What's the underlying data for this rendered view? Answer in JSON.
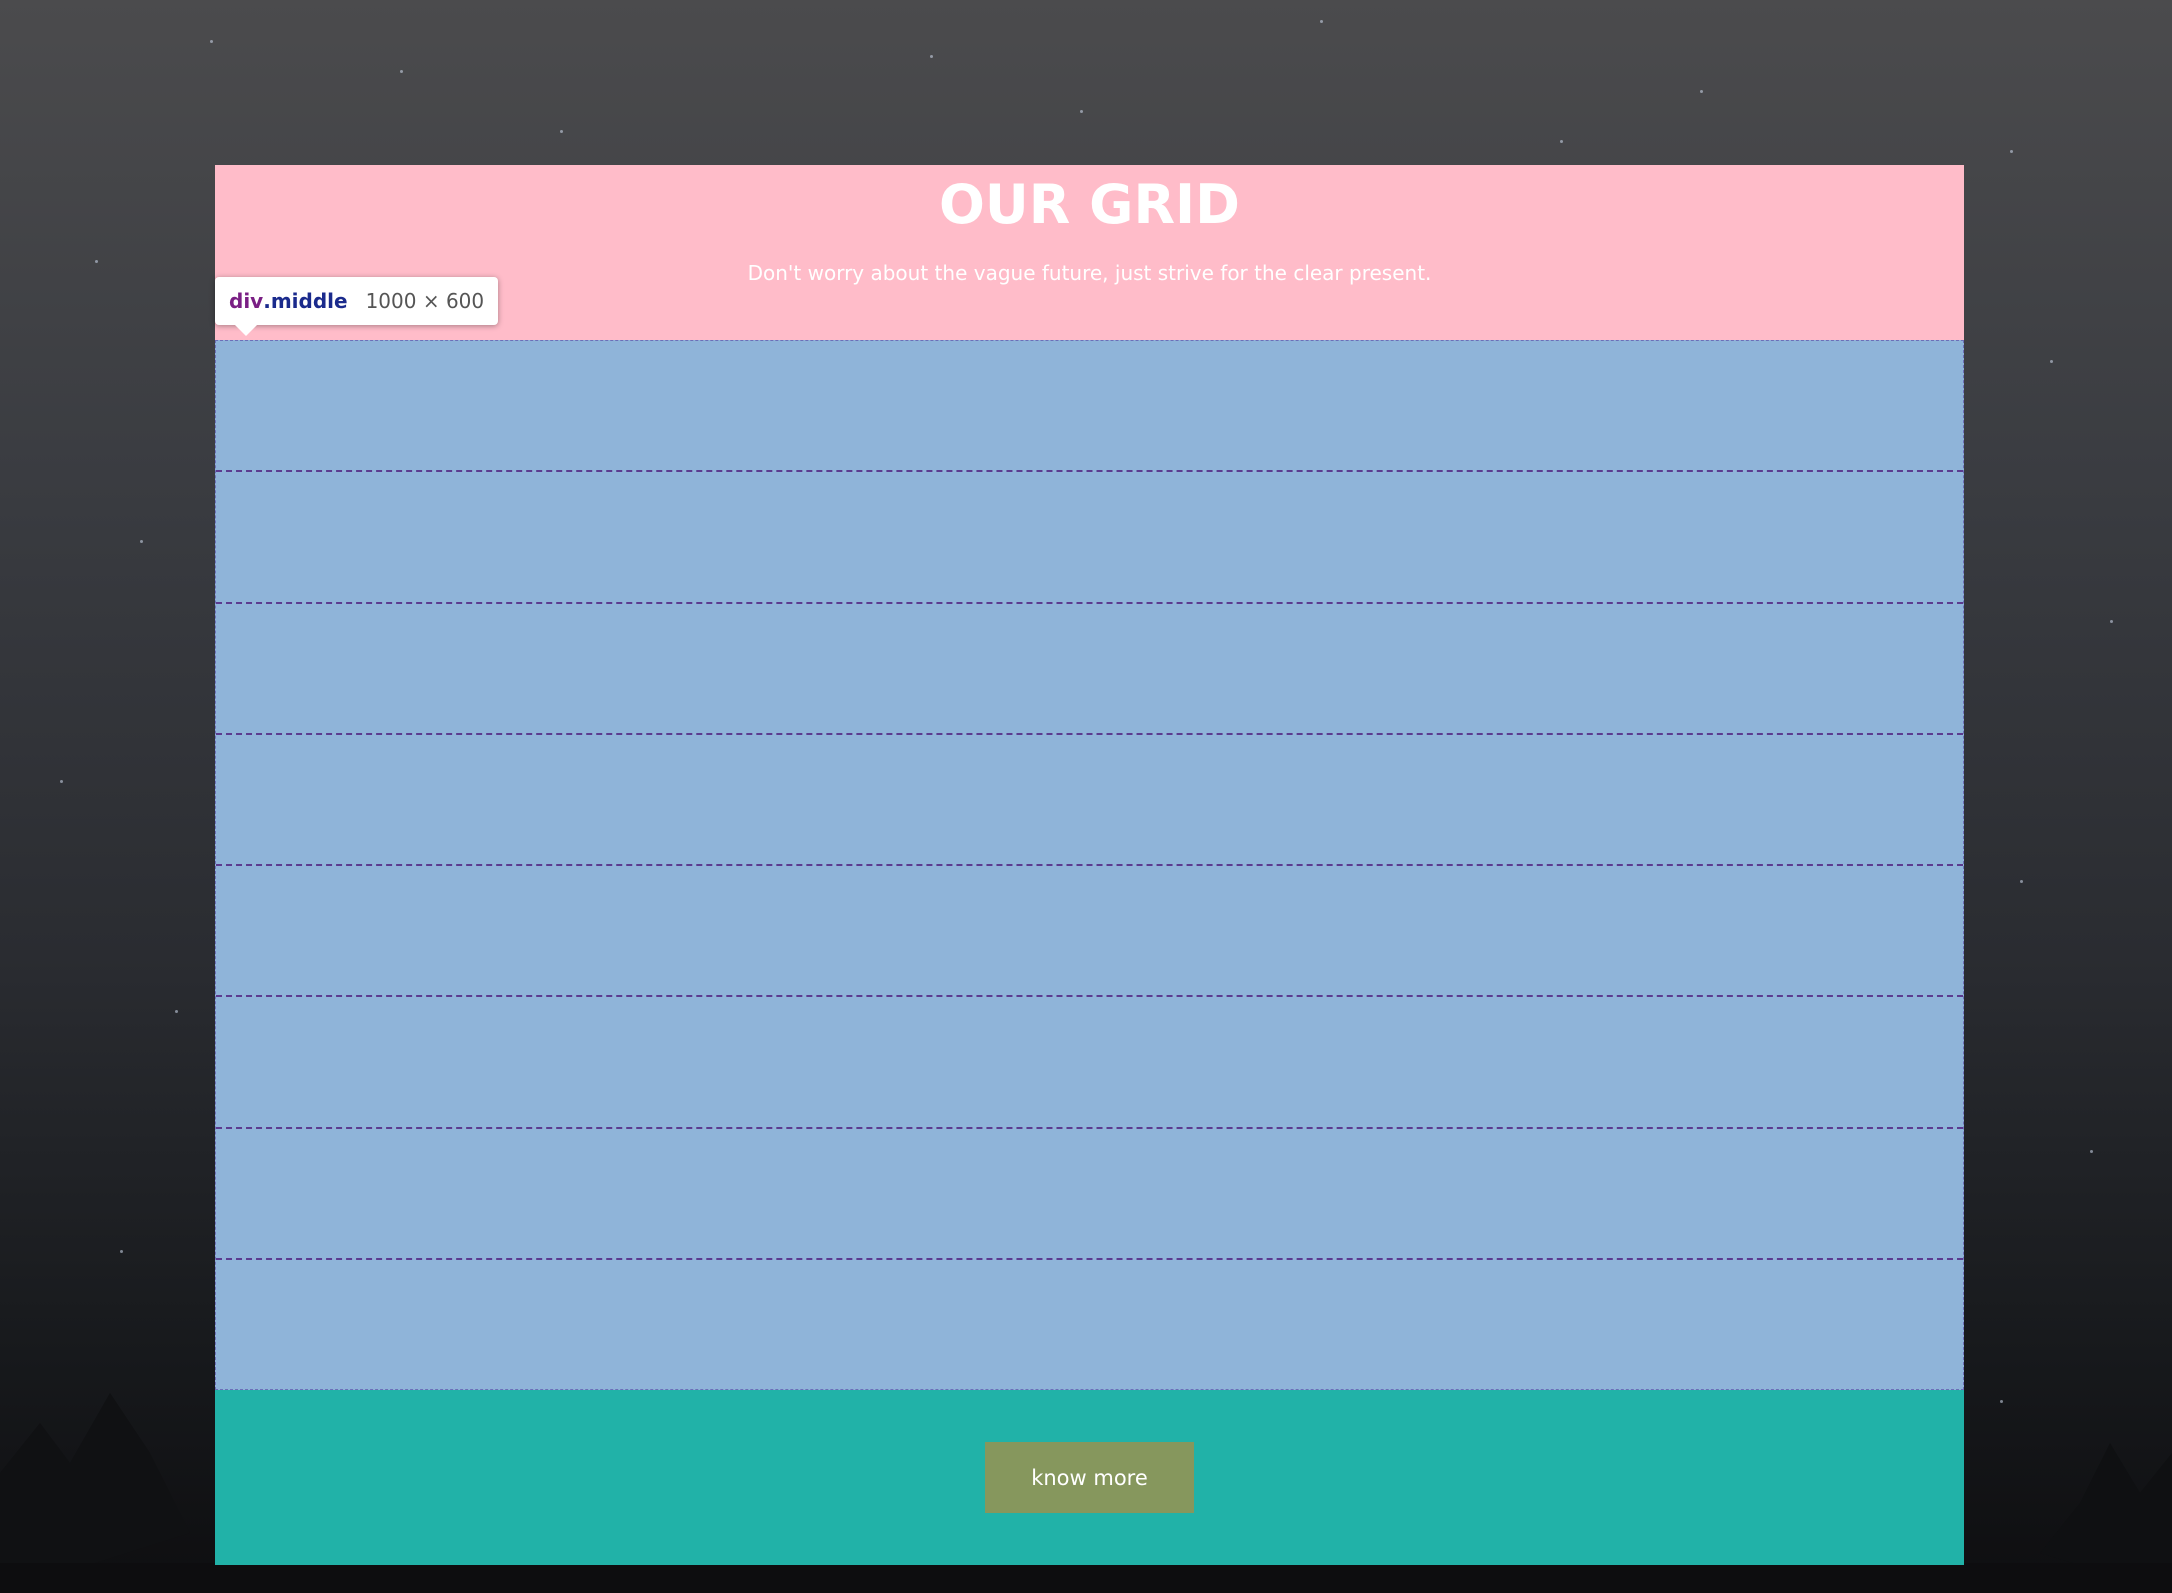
{
  "header": {
    "title": "OUR GRID",
    "subtitle": "Don't worry about the vague future, just strive for the clear present."
  },
  "middle": {
    "row_count": 8
  },
  "footer": {
    "button_label": "know more"
  },
  "inspector_tooltip": {
    "tag": "div",
    "class_name": ".middle",
    "dimensions": "1000 × 600"
  },
  "colors": {
    "header_bg": "#ffbcc9",
    "middle_bg": "#8fb4d9",
    "footer_bg": "#21b2a8",
    "button_bg": "#86975d",
    "row_divider": "#5b3b8f"
  }
}
